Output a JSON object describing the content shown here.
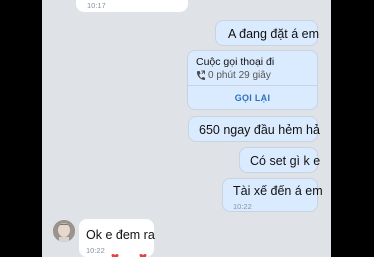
{
  "messages": [
    {
      "id": "b0",
      "direction": "incoming",
      "time": "10:17"
    },
    {
      "id": "b1",
      "direction": "outgoing",
      "text": "A đang đặt á em"
    },
    {
      "id": "b2",
      "direction": "outgoing",
      "type": "call",
      "title": "Cuộc gọi thoại đi",
      "duration": "0 phút 29 giây",
      "callback_label": "GỌI LẠI"
    },
    {
      "id": "b3",
      "direction": "outgoing",
      "text": "650 ngay đầu hẻm hả"
    },
    {
      "id": "b4",
      "direction": "outgoing",
      "text": "Có set gì k e"
    },
    {
      "id": "b5",
      "direction": "outgoing",
      "text": "Tài xế đến á em",
      "time": "10:22"
    },
    {
      "id": "b6",
      "direction": "incoming",
      "text": "Ok e đem ra",
      "time": "10:22"
    }
  ],
  "icons": {
    "phone": "phone-outgoing-icon",
    "reaction": "heart-icon"
  },
  "colors": {
    "outgoing_bubble": "#dbebff",
    "incoming_bubble": "#ffffff",
    "background": "#dfe3e8",
    "accent": "#2b71c4"
  }
}
